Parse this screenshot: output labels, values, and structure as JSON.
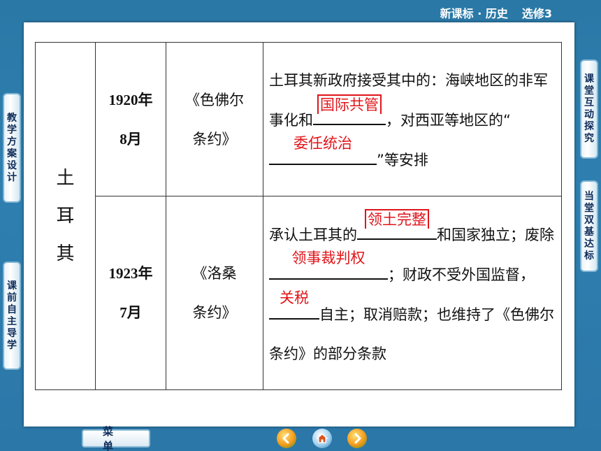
{
  "header": {
    "subject": "新课标 · 历史",
    "volume": "选修3"
  },
  "side_tabs": {
    "left_1": [
      "教",
      "学",
      "方",
      "案",
      "设",
      "计"
    ],
    "left_2": [
      "课",
      "前",
      "自",
      "主",
      "导",
      "学"
    ],
    "right_1": [
      "课",
      "堂",
      "互",
      "动",
      "探",
      "究"
    ],
    "right_2": [
      "当",
      "堂",
      "双",
      "基",
      "达",
      "标"
    ]
  },
  "table": {
    "country_lines": [
      "土",
      "耳",
      "其"
    ],
    "rows": [
      {
        "date_line1": "1920年",
        "date_line2": "8月",
        "treaty_line1": "《色佛尔",
        "treaty_line2": "条约》",
        "text_a": "土耳其新政府接受其中的：海峡地区的非军事化和",
        "answer_1": "国际共管",
        "text_b": "，对西亚等地区的“",
        "answer_2": "委任统治",
        "text_c": "”等安排"
      },
      {
        "date_line1": "1923年",
        "date_line2": "7月",
        "treaty_line1": "《洛桑",
        "treaty_line2": "条约》",
        "text_a": "承认土耳其的",
        "answer_1": "领土完整",
        "text_b": "和国家独立；废除",
        "answer_2": "领事裁判权",
        "text_c": "；财政不受外国监督，",
        "answer_3": "关税",
        "text_d": "自主；取消赔款；也维持了《色佛尔条约》的部分条款"
      }
    ]
  },
  "footer": {
    "menu_label": "菜单"
  },
  "icons": {
    "prev": "back-arrow-icon",
    "home": "home-icon",
    "next": "forward-arrow-icon"
  }
}
